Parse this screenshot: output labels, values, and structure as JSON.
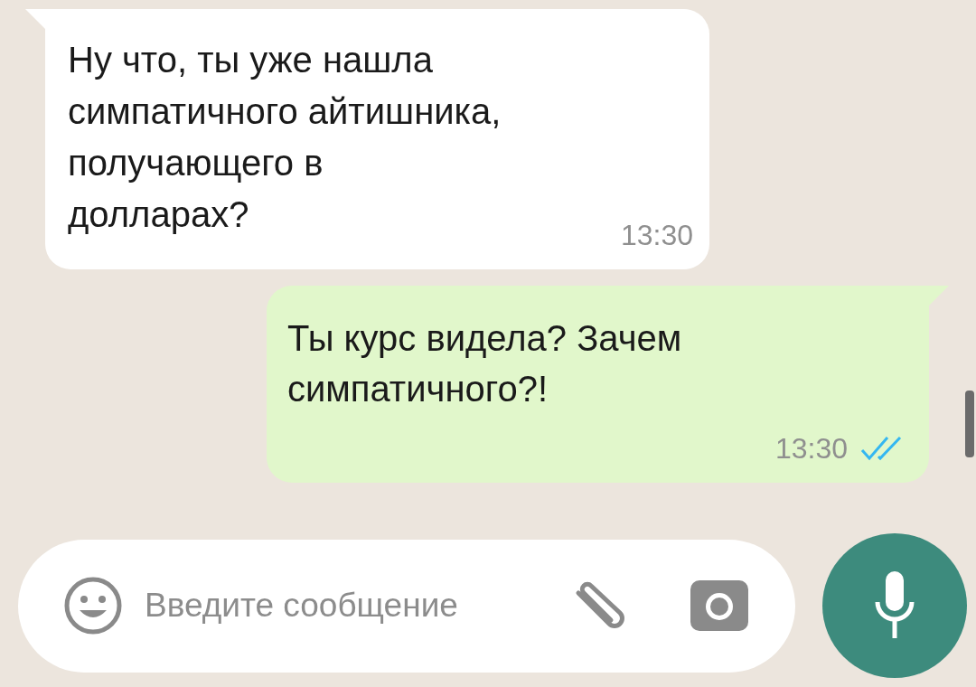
{
  "messages": [
    {
      "kind": "incoming",
      "text": "Ну что, ты уже нашла симпатичного айтишника, получающего в долларах?",
      "time": "13:30"
    },
    {
      "kind": "outgoing",
      "text": "Ты курс видела? Зачем симпатичного?!",
      "time": "13:30",
      "read": true
    }
  ],
  "composer": {
    "placeholder": "Введите сообщение"
  }
}
